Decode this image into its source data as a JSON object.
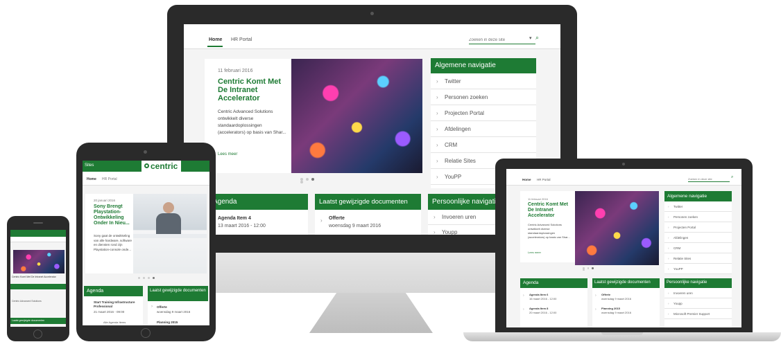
{
  "colors": {
    "brand_green": "#1e7b34",
    "device_black": "#2a2a2a"
  },
  "desktop": {
    "tabs": [
      "Home",
      "HR Portal"
    ],
    "search_placeholder": "Zoeken in deze site",
    "news": {
      "date": "11 februari 2016",
      "title": "Centric Komt Met De Intranet Accelerator",
      "body": "Centric Advanced Solutions ontwikkelt diverse standaardoplossingen (accelerators) op basis van Shar...",
      "more": "Lees meer"
    },
    "nav_title": "Algemene navigatie",
    "nav_items": [
      "Twitter",
      "Personen zoeken",
      "Projecten Portal",
      "Afdelingen",
      "CRM",
      "Relatie Sites",
      "YouPP"
    ],
    "agenda_title": "Agenda",
    "agenda_item": {
      "title": "Agenda Item 4",
      "date": "13 maart 2016 - 12:00"
    },
    "docs_title": "Laatst gewijzigde documenten",
    "doc_item": {
      "title": "Offerte",
      "date": "woensdag 9 maart 2016"
    },
    "personal_title": "Persoonlijke navigatie",
    "personal_items": [
      "Invoeren uren",
      "Youpp"
    ]
  },
  "tablet": {
    "site": "Sites",
    "logo": "centric",
    "tabs": [
      "Home",
      "HR Portal"
    ],
    "news": {
      "date": "20 januari 2016",
      "title": "Sony Brengt Playstation-Ontwikkeling Onder In Nieu...",
      "body": "Sony gaat de ontwikkeling van alle hardware, software en diensten rond zijn Playstation-console onde..."
    },
    "agenda_title": "Agenda",
    "agenda_item": {
      "title": "Start Training Infrastructure Professional",
      "date": "21 maart 2016 - 09:00"
    },
    "agenda_more": "Alle Agenda Items",
    "docs_title": "Laatst gewijzigde documenten",
    "doc_items": [
      {
        "title": "Offerte",
        "date": "woensdag 9 maart 2016"
      },
      {
        "title": "Planning 2015",
        "date": ""
      }
    ]
  },
  "phone": {
    "caption": "Centric Komt Met De Intranet Accelerator",
    "link": "Centric Advanced Solutions",
    "bar": "Laatst gewijzigde documenten"
  },
  "laptop": {
    "tabs": [
      "Home",
      "HR Portal"
    ],
    "search_placeholder": "Zoeken in deze site",
    "news": {
      "date": "11 februari 2016",
      "title": "Centric Komt Met De Intranet Accelerator",
      "body": "Centric Advanced Solutions ontwikkelt diverse standaardoplossingen (accelerators) op basis van Shar...",
      "more": "Lees meer"
    },
    "nav_title": "Algemene navigatie",
    "nav_items": [
      "Twitter",
      "Personen zoeken",
      "Projecten Portal",
      "Afdelingen",
      "CRM",
      "Relatie Sites",
      "YouPP"
    ],
    "agenda_title": "Agenda",
    "agenda_items": [
      {
        "title": "Agenda Item 6",
        "date": "16 maart 2016 - 12:00"
      },
      {
        "title": "Agenda Item 8",
        "date": "20 maart 2016 - 12:00"
      }
    ],
    "docs_title": "Laatst gewijzigde documenten",
    "doc_items": [
      {
        "title": "Offerte",
        "date": "woensdag 9 maart 2016"
      },
      {
        "title": "Planning 2015",
        "date": "woensdag 9 maart 2016"
      }
    ],
    "personal_title": "Persoonlijke navigatie",
    "personal_items": [
      "Invoeren uren",
      "Youpp",
      "Microsoft Premier Support"
    ]
  }
}
